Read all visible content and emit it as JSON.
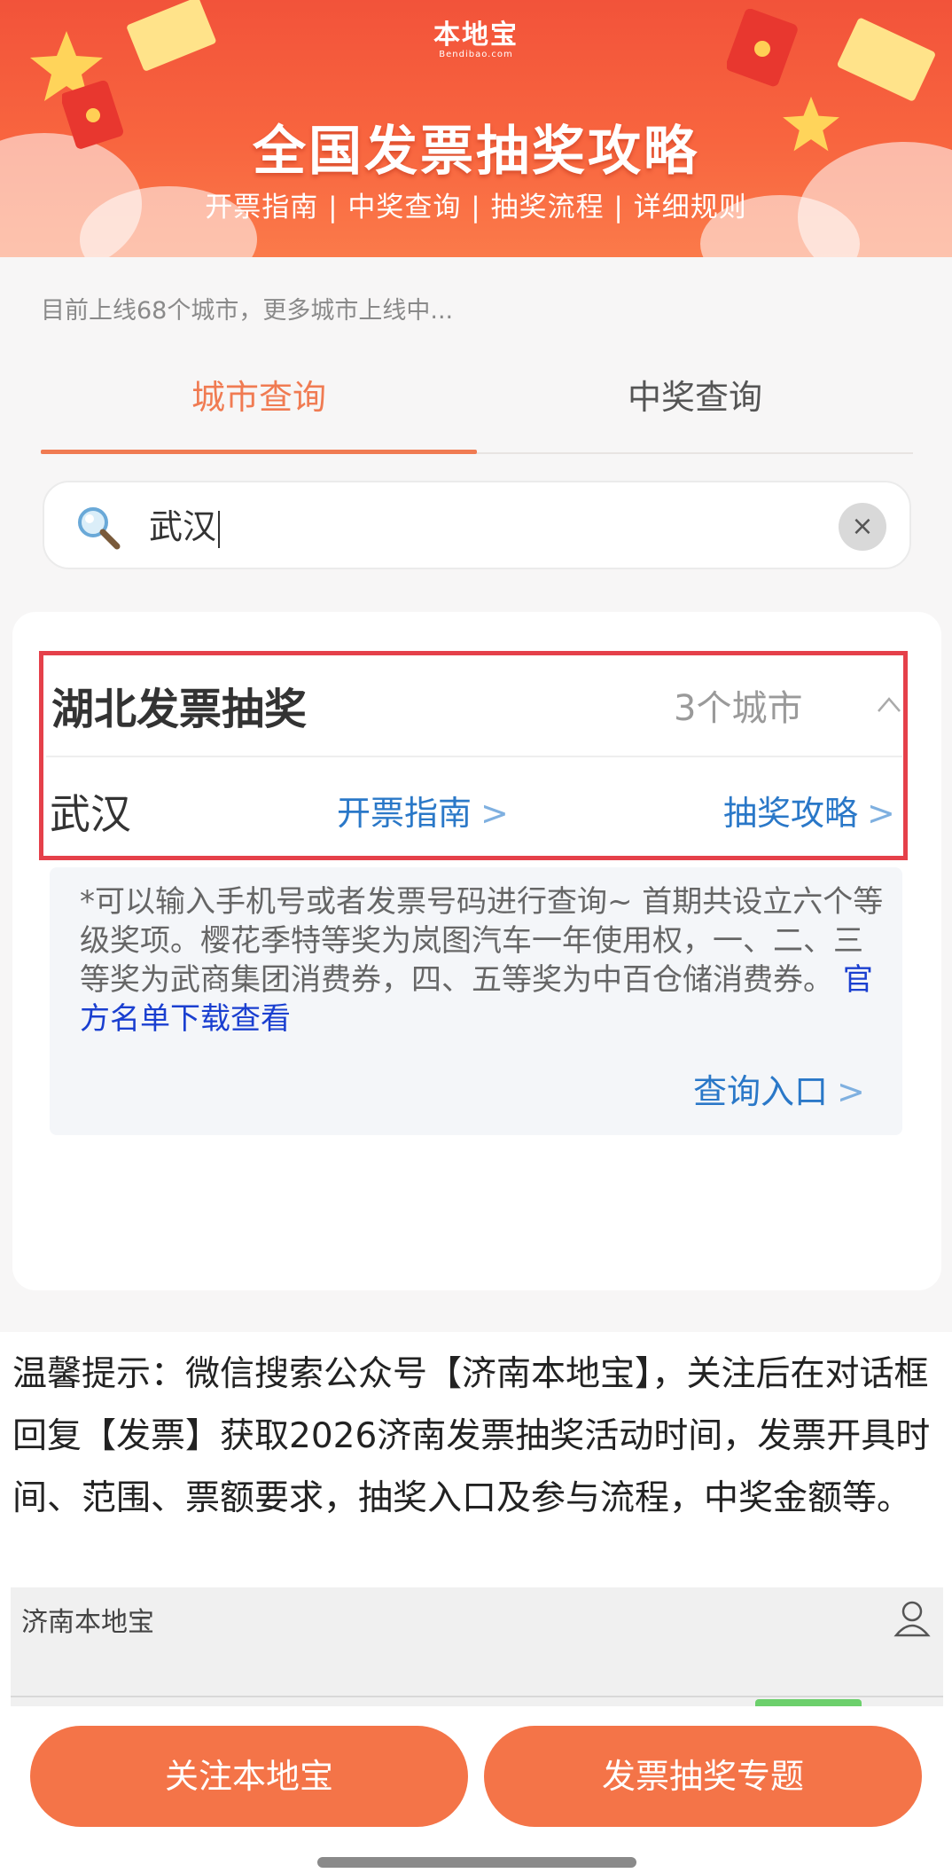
{
  "banner": {
    "logo_text": "本地宝",
    "logo_sub": "Bendibao.com",
    "title": "全国发票抽奖攻略",
    "subtitle": "开票指南 | 中奖查询 | 抽奖流程 | 详细规则"
  },
  "notice": "目前上线68个城市，更多城市上线中...",
  "tabs": [
    {
      "label": "城市查询",
      "active": true
    },
    {
      "label": "中奖查询",
      "active": false
    }
  ],
  "search": {
    "value": "武汉",
    "icon": "search-icon",
    "clear_icon": "×"
  },
  "result": {
    "province": "湖北发票抽奖",
    "city_count": "3个城市",
    "city": "武汉",
    "link_invoice_guide": "开票指南",
    "link_lottery_guide": "抽奖攻略",
    "chevron": ">"
  },
  "info": {
    "text": "*可以输入手机号或者发票号码进行查询~ 首期共设立六个等级奖项。樱花季特等奖为岚图汽车一年使用权，一、二、三等奖为武商集团消费券，四、五等奖为中百仓储消费券。",
    "link": "官方名单下载查看",
    "query_entry": "查询入口"
  },
  "tip": "温馨提示：微信搜索公众号【济南本地宝】，关注后在对话框回复【发票】获取2026济南发票抽奖活动时间，发票开具时间、范围、票额要求，抽奖入口及参与流程，中奖金额等。",
  "preview": {
    "title": "济南本地宝",
    "icon": "person-icon"
  },
  "buttons": {
    "follow": "关注本地宝",
    "topic": "发票抽奖专题"
  },
  "colors": {
    "accent": "#f07b52",
    "button": "#f47448",
    "link": "#2a78c8",
    "highlight_border": "#e5404a",
    "banner": "#f2533a"
  }
}
